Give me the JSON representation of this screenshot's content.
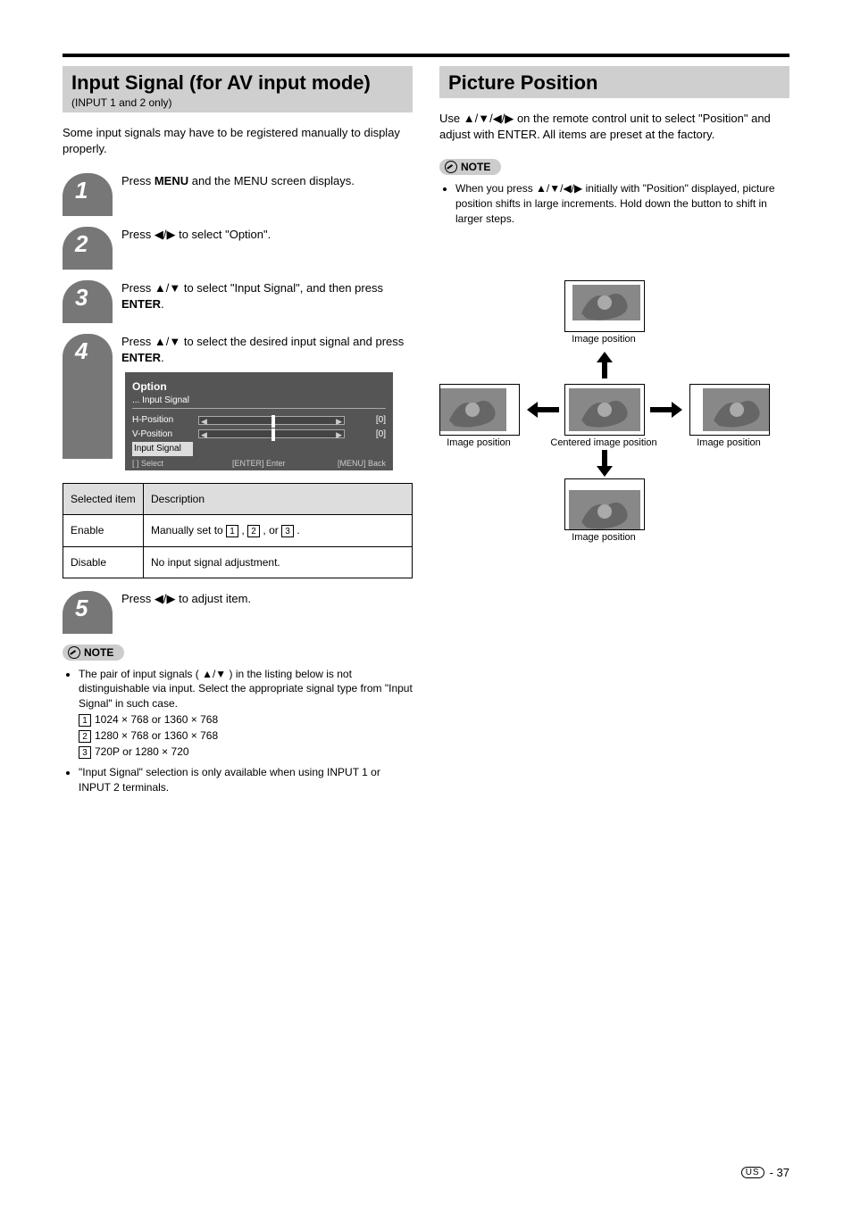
{
  "left": {
    "section_title": "Input Signal (for AV input mode)",
    "section_sub": "(INPUT 1 and 2 only)",
    "intro": "Some input signals may have to be registered manually to display properly.",
    "steps": {
      "1": "Press MENU and the MENU screen displays.",
      "2_a": "Press ",
      "2_b": " to select \"Option\".",
      "3_a": "Press ",
      "3_b": " to select \"Input Signal\", and then press ENTER.",
      "4_a": "Press ",
      "4_b": " to select the desired input signal and press ENTER."
    },
    "option_screen": {
      "title": "Option",
      "sub": "... Input Signal",
      "rows": [
        {
          "label": "H-Position",
          "val": "0"
        },
        {
          "label": "V-Position",
          "val": "0"
        },
        {
          "label": "Input Signal"
        }
      ],
      "hint_select": "[ ] Select",
      "hint_enter": "[ENTER] Enter",
      "hint_back": "[MENU] Back"
    },
    "table": {
      "h1": "Selected item",
      "h2": "Description",
      "r1c1": "Enable",
      "r1c2": "Manually set to  ,  , or  .",
      "r1c2_parts": [
        "Manually set to ",
        "1",
        ", ",
        "2",
        ", or ",
        "3",
        "."
      ],
      "r2c1": "Disable",
      "r2c2": "No input signal adjustment."
    },
    "step5_a": "Press ",
    "step5_b": " to adjust item.",
    "note_label": "NOTE",
    "notes": [
      {
        "pre": "The pair of input signals (",
        "mid": ") in the listing below is not distinguishable via input. Select the appropriate signal type from \"Input Signal\" in such case.",
        "tri_between": "/"
      },
      "1: 1024 x 768 or 1360 x 768",
      "2: 1280 x 768 or 1360 x 768",
      "3: 720P or 1280 x 720",
      "\"Input Signal\" selection is only available when using INPUT 1 or INPUT 2 terminals."
    ]
  },
  "right": {
    "section_title": "Picture Position",
    "intro_a": "Use ",
    "intro_b": " on the remote control unit to select \"Position\" and adjust with ENTER. All items are preset at the factory.",
    "note_label": "NOTE",
    "note_a": "When you press ",
    "note_b": " initially with \"Position\" displayed, picture position shifts in large increments. Hold down the button to shift in larger steps.",
    "captions": {
      "top": "Image position",
      "left": "Image position",
      "center": "Centered image position",
      "right": "Image position",
      "bottom": "Image position"
    }
  },
  "footer": {
    "us": "US",
    "page": "- 37"
  }
}
